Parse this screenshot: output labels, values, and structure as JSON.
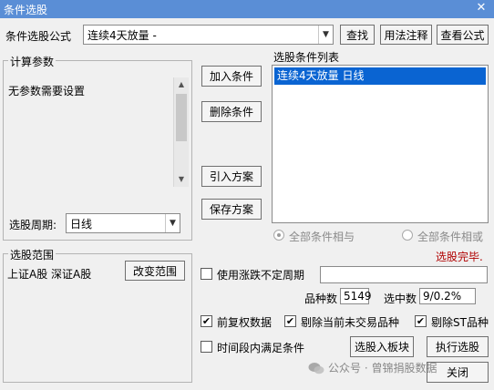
{
  "window": {
    "title": "条件选股",
    "close_glyph": "✕"
  },
  "formula": {
    "label": "条件选股公式",
    "selected_value": "连续4天放量  -",
    "find_button": "查找",
    "usage_button": "用法注释",
    "view_button": "查看公式"
  },
  "params": {
    "group_label": "计算参数",
    "message": "无参数需要设置",
    "period_label": "选股周期:",
    "period_value": "日线"
  },
  "actions": {
    "add_condition": "加入条件",
    "delete_condition": "删除条件",
    "import_scheme": "引入方案",
    "save_scheme": "保存方案"
  },
  "condition_list": {
    "label": "选股条件列表",
    "items": [
      "连续4天放量  日线"
    ],
    "radio_and": "全部条件相与",
    "radio_or": "全部条件相或",
    "status_text": "选股完毕."
  },
  "scope": {
    "group_label": "选股范围",
    "markets": "上证A股 深证A股",
    "change_button": "改变范围"
  },
  "options": {
    "use_variable_period": "使用涨跌不定周期",
    "count_label": "品种数",
    "count_value": "5149",
    "selected_label": "选中数",
    "selected_value": "9/0.2%",
    "pre_adjusted": "前复权数据",
    "exclude_untraded": "剔除当前未交易品种",
    "exclude_st": "剔除ST品种",
    "time_range": "时间段内满足条件",
    "to_block_button": "选股入板块",
    "run_button": "执行选股",
    "close_button": "关闭"
  },
  "overlay": {
    "watermark": "公众号 · 曾锦捐股数据"
  },
  "colors": {
    "titlebar": "#5a8ed6",
    "selection": "#0a64d2",
    "status": "#b00000"
  },
  "icons": {
    "dropdown": "chevron-down-icon",
    "checked": "checkmark-icon",
    "watermark": "wechat-icon"
  }
}
